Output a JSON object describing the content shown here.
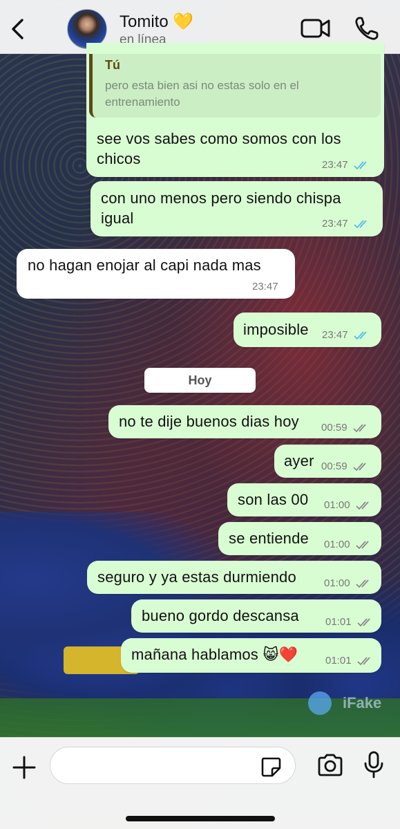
{
  "header": {
    "back_label": "<",
    "contact_name": "Tomito 💛",
    "status": "en línea",
    "video_icon": "video-camera-icon",
    "call_icon": "phone-icon"
  },
  "quoted": {
    "author": "Tú",
    "text": "pero esta bien asi no estas solo en el entrenamiento"
  },
  "messages": [
    {
      "text": "see vos sabes como somos con los chicos",
      "time": "23:47",
      "direction": "out",
      "status": "read"
    },
    {
      "text": "con uno menos pero siendo chispa igual",
      "time": "23:47",
      "direction": "out",
      "status": "read"
    },
    {
      "text": "no hagan enojar al capi nada mas",
      "time": "23:47",
      "direction": "in"
    },
    {
      "text": "imposible",
      "time": "23:47",
      "direction": "out",
      "status": "read"
    },
    {
      "text": "no te dije buenos dias hoy",
      "time": "00:59",
      "direction": "out",
      "status": "delivered"
    },
    {
      "text": "ayer",
      "time": "00:59",
      "direction": "out",
      "status": "delivered"
    },
    {
      "text": "son las 00",
      "time": "01:00",
      "direction": "out",
      "status": "delivered"
    },
    {
      "text": "se entiende",
      "time": "01:00",
      "direction": "out",
      "status": "delivered"
    },
    {
      "text": "seguro y ya estas durmiendo",
      "time": "01:00",
      "direction": "out",
      "status": "delivered"
    },
    {
      "text": "bueno gordo descansa",
      "time": "01:01",
      "direction": "out",
      "status": "delivered"
    },
    {
      "text": "mañana hablamos 😸❤️",
      "time": "01:01",
      "direction": "out",
      "status": "delivered"
    }
  ],
  "day_separator": "Hoy",
  "watermark": "iFake",
  "composer": {
    "placeholder": "",
    "value": ""
  },
  "colors": {
    "outgoing_bubble": "#d9fdd3",
    "incoming_bubble": "#ffffff",
    "read_ticks": "#53bdeb",
    "delivered_ticks": "#8a8a8a"
  }
}
